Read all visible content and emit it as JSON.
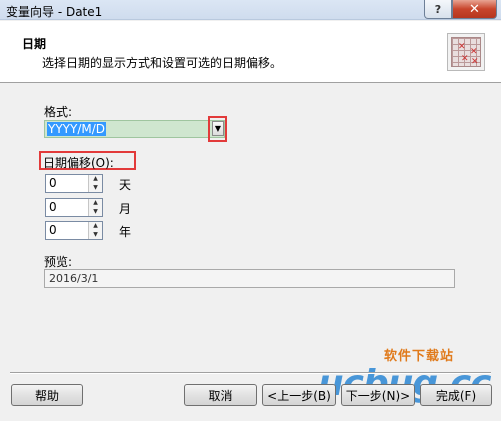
{
  "window": {
    "title": "变量向导 - Date1",
    "help_glyph": "?",
    "close_glyph": "✕"
  },
  "header": {
    "title": "日期",
    "subtitle": "选择日期的显示方式和设置可选的日期偏移。"
  },
  "format": {
    "label": "格式:",
    "selected": "YYYY/M/D"
  },
  "offset": {
    "label": "日期偏移(O):",
    "rows": [
      {
        "value": "0",
        "unit": "天"
      },
      {
        "value": "0",
        "unit": "月"
      },
      {
        "value": "0",
        "unit": "年"
      }
    ]
  },
  "preview": {
    "label": "预览:",
    "value": "2016/3/1"
  },
  "buttons": {
    "help": "帮助",
    "cancel": "取消",
    "back": "<上一步(B)",
    "next": "下一步(N)>",
    "finish": "完成(F)"
  },
  "watermark": {
    "site_name": "软件下载站",
    "logo": "ucbug.cc"
  },
  "colors": {
    "highlight_box": "#e23a3a",
    "selection": "#3399ff"
  }
}
